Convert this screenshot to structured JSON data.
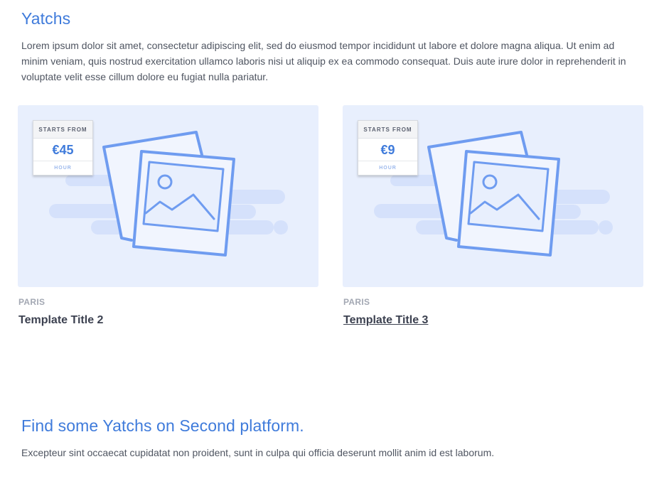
{
  "section": {
    "title": "Yatchs",
    "description": "Lorem ipsum dolor sit amet, consectetur adipiscing elit, sed do eiusmod tempor incididunt ut labore et dolore magna aliqua. Ut enim ad minim veniam, quis nostrud exercitation ullamco laboris nisi ut aliquip ex ea commodo consequat. Duis aute irure dolor in reprehenderit in voluptate velit esse cillum dolore eu fugiat nulla pariatur."
  },
  "cards": [
    {
      "price_label": "STARTS FROM",
      "price": "€45",
      "price_unit": "HOUR",
      "location": "PARIS",
      "title": "Template Title 2",
      "image_icon": "image-placeholder-icon"
    },
    {
      "price_label": "STARTS FROM",
      "price": "€9",
      "price_unit": "HOUR",
      "location": "PARIS",
      "title": "Template Title 3",
      "image_icon": "image-placeholder-icon"
    }
  ],
  "footer_section": {
    "title": "Find some Yatchs on Second platform.",
    "description": "Excepteur sint occaecat cupidatat non proident, sunt in culpa qui officia deserunt mollit anim id est laborum."
  },
  "colors": {
    "accent": "#3f7bdb",
    "card_background": "#e8effd",
    "illustration_stroke": "#6f9cf0",
    "illustration_blob": "#d5e1fb"
  }
}
